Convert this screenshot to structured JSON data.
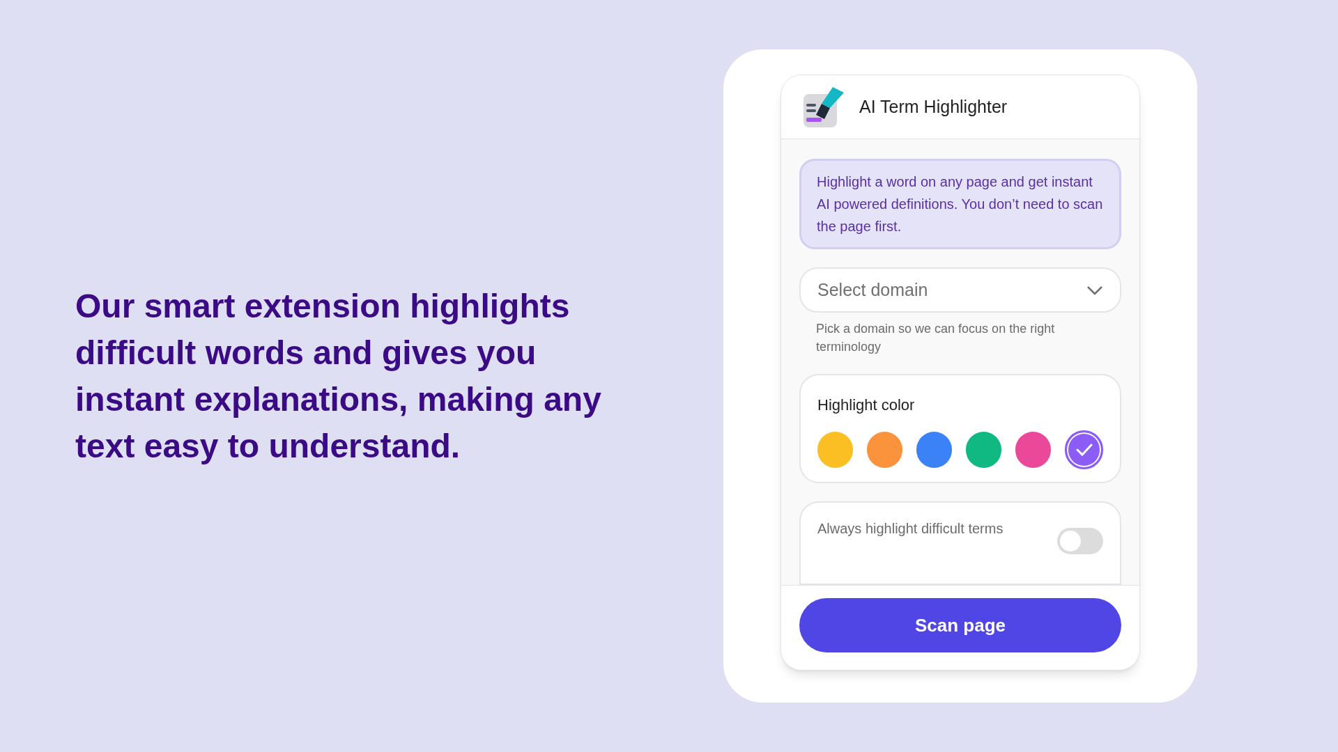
{
  "headline": "Our smart extension highlights difficult words and gives you instant explanations, making any text easy to understand.",
  "popup": {
    "title": "AI Term Highlighter",
    "info": "Highlight a word on any page and get instant AI powered definitions. You don’t need to scan the page first.",
    "domain_select": {
      "placeholder": "Select domain"
    },
    "domain_hint": "Pick a domain so we can focus on the right terminology",
    "highlight_color": {
      "label": "Highlight color",
      "swatches": [
        {
          "color": "#fbbf24",
          "selected": false
        },
        {
          "color": "#fb923c",
          "selected": false
        },
        {
          "color": "#3b82f6",
          "selected": false
        },
        {
          "color": "#10b981",
          "selected": false
        },
        {
          "color": "#ec4899",
          "selected": false
        },
        {
          "color": "#8b5cf6",
          "selected": true
        }
      ]
    },
    "auto_highlight": {
      "label": "Always highlight difficult terms",
      "on": false
    },
    "scan_button": "Scan page"
  }
}
